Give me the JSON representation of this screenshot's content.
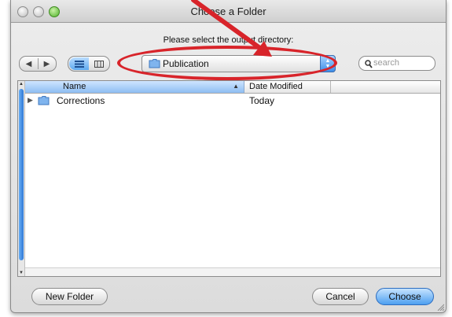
{
  "window": {
    "title": "Choose a Folder"
  },
  "prompt": "Please select the output directory:",
  "toolbar": {
    "back_glyph": "◀",
    "forward_glyph": "▶",
    "location": "Publication",
    "search_placeholder": "search"
  },
  "browser": {
    "columns": {
      "name": "Name",
      "date": "Date Modified"
    },
    "rows": [
      {
        "name": "Corrections",
        "date": "Today"
      }
    ]
  },
  "buttons": {
    "new_folder": "New Folder",
    "cancel": "Cancel",
    "choose": "Choose"
  },
  "colors": {
    "annotation_red": "#d8242a",
    "accent_blue": "#4d9ff0"
  },
  "icons": {
    "folder": "folder-icon",
    "search": "magnifier-icon",
    "list_view": "list-view-icon",
    "column_view": "column-view-icon"
  }
}
